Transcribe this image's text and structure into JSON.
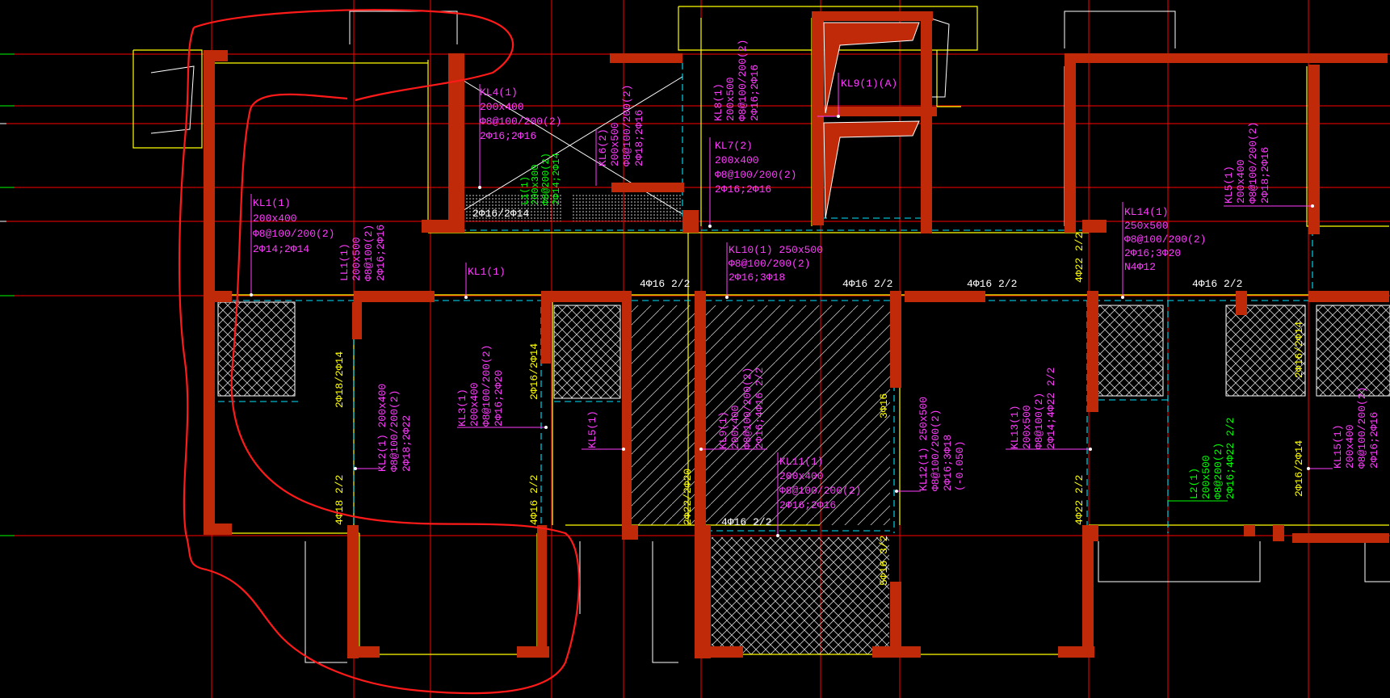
{
  "drawing": {
    "colors": {
      "background": "#000000",
      "axis_line": "#ff0000",
      "wall": "#c02a08",
      "outline": "#ffff00",
      "beam_dash": "#00e5ff",
      "beam_label": "#ff3cff",
      "rebar_label": "#ffff00",
      "green_label": "#00ff00",
      "white": "#ffffff",
      "hatch": "#d0d0d0",
      "markup": "#ff1a1a"
    },
    "beam_labels": {
      "kl4": [
        "KL4(1)",
        "200x400",
        "Φ8@100/200(2)",
        "2Φ16;2Φ16"
      ],
      "kl6": [
        "KL6(2)",
        "200x500",
        "Φ8@100/200(2)",
        "2Φ18;2Φ16"
      ],
      "kl8": [
        "KL8(1)",
        "200x500",
        "Φ8@100/200(2)",
        "2Φ16;2Φ16"
      ],
      "kl9": [
        "KL9(1)(A)"
      ],
      "kl7": [
        "KL7(2)",
        "200x400",
        "Φ8@100/200(2)",
        "2Φ16;2Φ16"
      ],
      "kl1_top": [
        "KL1(1)",
        "200x400",
        "Φ8@100/200(2)",
        "2Φ14;2Φ14"
      ],
      "ll1": [
        "LL1(1)",
        "200x500",
        "Φ8@100(2)",
        "2Φ16;2Φ16"
      ],
      "kl1_mid": [
        "KL1(1)"
      ],
      "kl10": [
        "KL10(1) 250x500",
        "Φ8@100/200(2)",
        "2Φ16;3Φ18"
      ],
      "kl14": [
        "KL14(1)",
        "250x500",
        "Φ8@100/200(2)",
        "2Φ16;3Φ20",
        "N4Φ12"
      ],
      "kl5_right": [
        "KL5(1)",
        "200x400",
        "Φ8@100/200(2)",
        "2Φ18;2Φ16"
      ],
      "kl2": [
        "KL2(1) 200x400",
        "Φ8@100/200(2)",
        "2Φ18;2Φ22"
      ],
      "kl3": [
        "KL3(1)",
        "200x400",
        "Φ8@100/200(2)",
        "2Φ16;2Φ20"
      ],
      "kl5_mid": [
        "KL5(1)"
      ],
      "kl9_mid": [
        "KL9(1)",
        "200x400",
        "Φ8@100/200(2)",
        "2Φ16;4Φ16 2/2"
      ],
      "kl11": [
        "KL11(1)",
        "200x400",
        "Φ8@100/200(2)",
        "2Φ16;2Φ16"
      ],
      "kl12": [
        "KL12(1) 250x500",
        "Φ8@100/200(2)",
        "2Φ16;3Φ18",
        "(-0.050)"
      ],
      "kl13": [
        "KL13(1)",
        "200x500",
        "Φ8@100(2)",
        "2Φ14;4Φ22 2/2"
      ],
      "l2": [
        "L2(1)",
        "200x500",
        "Φ8@200(2)",
        "2Φ16;4Φ22 2/2"
      ],
      "kl15": [
        "KL15(1)",
        "200x400",
        "Φ8@100/200(2)",
        "2Φ16;2Φ16"
      ],
      "l1_green": [
        "L1(1)",
        "200x300",
        "Φ8@200(2)",
        "2Φ14;2Φ14"
      ]
    },
    "rebar_labels": {
      "r1": "2Φ16/2Φ14",
      "r2": "4Φ16 2/2",
      "r3": "4Φ16 2/2",
      "r4": "4Φ16 2/2",
      "r5": "4Φ22 2/2",
      "r6": "4Φ16 2/2",
      "r7": "2Φ18/2Φ14",
      "r8": "4Φ18 2/2",
      "r9": "2Φ16/2Φ14",
      "r10": "4Φ16 2/2",
      "r11": "2Φ22/2Φ20",
      "r12": "4Φ16 2/2",
      "r13": "3Φ16",
      "r14": "5Φ16 3/2",
      "r15": "4Φ22 2/2",
      "r16": "2Φ16/2Φ14",
      "r17": "2Φ16/2Φ14"
    }
  }
}
